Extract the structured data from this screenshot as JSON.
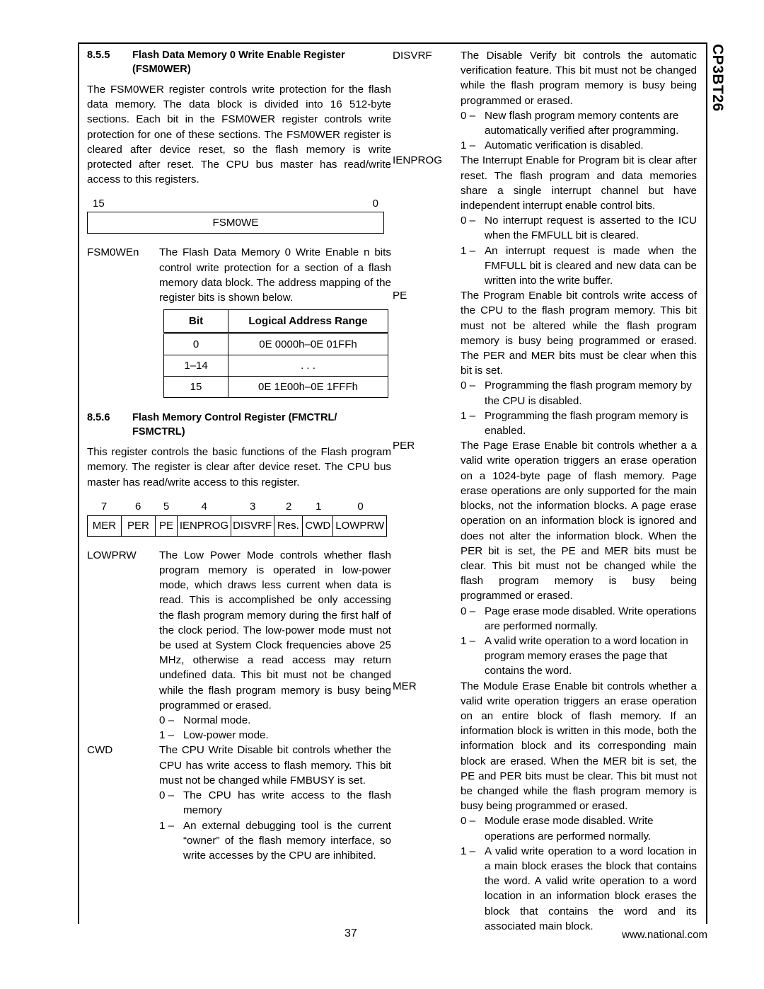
{
  "document": {
    "side_title": "CP3BT26",
    "footer_page_number": "37",
    "footer_url": "www.national.com"
  },
  "left_column": {
    "section_855": {
      "number": "8.5.5",
      "title_line1": "Flash Data Memory 0 Write Enable Register",
      "title_line2": "(FSM0WER)",
      "intro": "The FSM0WER register controls write protection for the flash data memory. The data block is divided into 16 512-byte sections. Each bit in the FSM0WER register controls write protection for one of these sections. The FSM0WER register is cleared after device reset, so the flash memory is write protected after reset. The CPU bus master has read/write access to this registers.",
      "register_diagram": {
        "msb_label": "15",
        "lsb_label": "0",
        "field_name": "FSM0WE"
      },
      "field": {
        "label": "FSM0WEn",
        "description": "The Flash Data Memory 0 Write Enable n bits control write protection for a section of a flash memory data block. The address mapping of the register bits is shown below."
      },
      "address_table": {
        "headers": [
          "Bit",
          "Logical Address Range"
        ],
        "rows": [
          [
            "0",
            "0E 0000h–0E 01FFh"
          ],
          [
            "1–14",
            ". . ."
          ],
          [
            "15",
            "0E 1E00h–0E 1FFFh"
          ]
        ]
      }
    },
    "section_856": {
      "number": "8.5.6",
      "title_line1": "Flash Memory Control Register (FMCTRL/",
      "title_line2": "FSMCTRL)",
      "intro": "This register controls the basic functions of the Flash program memory. The register is clear after device reset. The CPU bus master has read/write access to this register.",
      "register_diagram": {
        "bit_numbers": [
          "7",
          "6",
          "5",
          "4",
          "3",
          "2",
          "1",
          "0"
        ],
        "fields": [
          "MER",
          "PER",
          "PE",
          "IENPROG",
          "DISVRF",
          "Res.",
          "CWD",
          "LOWPRW"
        ]
      },
      "definitions": [
        {
          "label": "LOWPRW",
          "description": "The Low Power Mode controls whether flash program memory is operated in low-power mode, which draws less current when data is read. This is accomplished be only accessing the flash program memory during the first half of the clock period. The low-power mode must not be used at System Clock frequencies above 25 MHz, otherwise a read access may return undefined data. This bit must not be changed while the flash program memory is busy being programmed or erased.",
          "values": [
            {
              "key": "0 –",
              "text": "Normal mode."
            },
            {
              "key": "1 –",
              "text": "Low-power mode."
            }
          ]
        },
        {
          "label": "CWD",
          "description": "The CPU Write Disable bit controls whether the CPU has write access to flash memory. This bit must not be changed while FMBUSY is set.",
          "values": [
            {
              "key": "0 –",
              "text": "The CPU has write access to the flash memory"
            },
            {
              "key": "1 –",
              "text": "An external debugging tool is the current “owner” of the flash memory interface, so write accesses by the CPU are inhibited."
            }
          ]
        }
      ]
    }
  },
  "right_column": {
    "definitions": [
      {
        "label": "DISVRF",
        "description": "The Disable Verify bit controls the automatic verification feature. This bit must not be changed while the flash program memory is busy being programmed or erased.",
        "values": [
          {
            "key": "0 –",
            "text": "New flash program memory contents are automatically verified after programming."
          },
          {
            "key": "1 –",
            "text": "Automatic verification is disabled."
          }
        ]
      },
      {
        "label": "IENPROG",
        "description": "The Interrupt Enable for Program bit is clear after reset. The flash program and data memories share a single interrupt channel but have independent interrupt enable control bits.",
        "values": [
          {
            "key": "0 –",
            "text": "No interrupt request is asserted to the ICU when the FMFULL bit is cleared."
          },
          {
            "key": "1 –",
            "text": "An interrupt request is made when the FMFULL bit is cleared and new data can be written into the write buffer."
          }
        ]
      },
      {
        "label": "PE",
        "description": "The Program Enable bit controls write access of the CPU to the flash program memory. This bit must not be altered while the flash program memory is busy being programmed or erased. The PER and MER bits must be clear when this bit is set.",
        "values": [
          {
            "key": "0 –",
            "text": "Programming the flash program memory by the CPU is disabled."
          },
          {
            "key": "1 –",
            "text": "Programming the flash program memory is enabled."
          }
        ]
      },
      {
        "label": "PER",
        "description": "The Page Erase Enable bit controls whether a a valid write operation triggers an erase operation on a 1024-byte page of flash memory. Page erase operations are only supported for the main blocks, not the information blocks. A page erase operation on an information block is ignored and does not alter the information block. When the PER bit is set, the PE and MER bits must be clear. This bit must not be changed while the flash program memory is busy being programmed or erased.",
        "values": [
          {
            "key": "0 –",
            "text": "Page erase mode disabled. Write operations are performed normally."
          },
          {
            "key": "1 –",
            "text": "A valid write operation to a word location in program memory erases the page that contains the word."
          }
        ]
      },
      {
        "label": "MER",
        "description": "The Module Erase Enable bit controls whether a valid write operation triggers an erase operation on an entire block of flash memory. If an information block is written in this mode, both the information block and its corresponding main block are erased. When the MER bit is set, the PE and PER bits must be clear. This bit must not be changed while the flash program memory is busy being programmed or erased.",
        "values": [
          {
            "key": "0 –",
            "text": "Module erase mode disabled. Write operations are performed normally."
          },
          {
            "key": "1 –",
            "text": "A valid write operation to a word location in a main block erases the block that contains the word. A valid write operation to a word location in an information block erases the block that contains the word and its associated main block."
          }
        ]
      }
    ]
  }
}
